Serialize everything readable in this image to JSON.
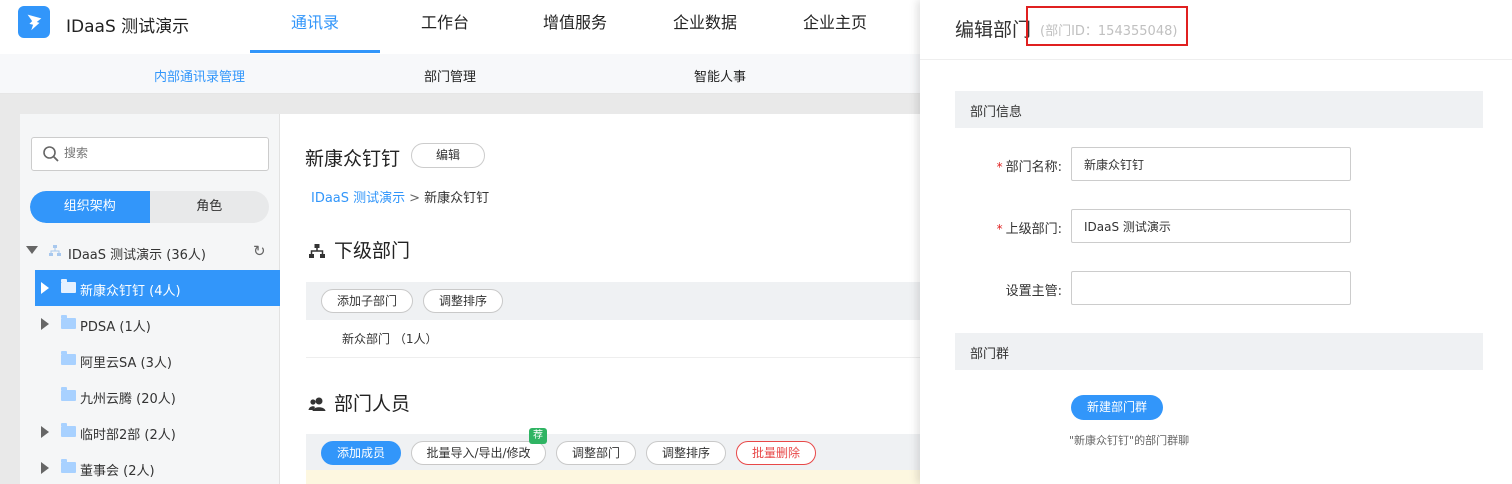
{
  "app": {
    "title": "IDaaS 测试演示"
  },
  "nav": {
    "items": [
      "通讯录",
      "工作台",
      "增值服务",
      "企业数据",
      "企业主页"
    ],
    "active": 0
  },
  "subnav": {
    "items": [
      "内部通讯录管理",
      "部门管理",
      "智能人事"
    ],
    "active": 0
  },
  "sidebar": {
    "search_placeholder": "搜索",
    "segments": [
      "组织架构",
      "角色"
    ],
    "root": {
      "label": "IDaaS 测试演示 (36人)"
    },
    "nodes": [
      {
        "label": "新康众钉钉 (4人)",
        "expandable": true,
        "active": true
      },
      {
        "label": "PDSA (1人)",
        "expandable": true,
        "active": false
      },
      {
        "label": "阿里云SA (3人)",
        "expandable": false,
        "active": false
      },
      {
        "label": "九州云腾 (20人)",
        "expandable": false,
        "active": false
      },
      {
        "label": "临时部2部 (2人)",
        "expandable": true,
        "active": false
      },
      {
        "label": "董事会 (2人)",
        "expandable": true,
        "active": false
      }
    ]
  },
  "main": {
    "dept_name": "新康众钉钉",
    "edit_label": "编辑",
    "breadcrumb": {
      "root": "IDaaS 测试演示",
      "sep": ">",
      "current": "新康众钉钉"
    },
    "subdept_heading": "下级部门",
    "subdept_toolbar": [
      "添加子部门",
      "调整排序"
    ],
    "subdept_rows": [
      "新众部门 （1人）"
    ],
    "members_heading": "部门人员",
    "members_toolbar": [
      "添加成员",
      "批量导入/导出/修改",
      "调整部门",
      "调整排序",
      "批量删除"
    ],
    "recommend_badge": "荐"
  },
  "drawer": {
    "title": "编辑部门",
    "dept_id": "(部门ID：154355048)",
    "info_section": "部门信息",
    "fields": {
      "name_label": "部门名称:",
      "name_value": "新康众钉钉",
      "parent_label": "上级部门:",
      "parent_value": "IDaaS 测试演示",
      "manager_label": "设置主管:",
      "manager_value": ""
    },
    "group_section": "部门群",
    "new_group_button": "新建部门群",
    "group_hint": "\"新康众钉钉\"的部门群聊"
  },
  "colors": {
    "accent": "#3296fa",
    "danger": "#e84848",
    "badge": "#2fb463",
    "highlight": "#e02020"
  }
}
